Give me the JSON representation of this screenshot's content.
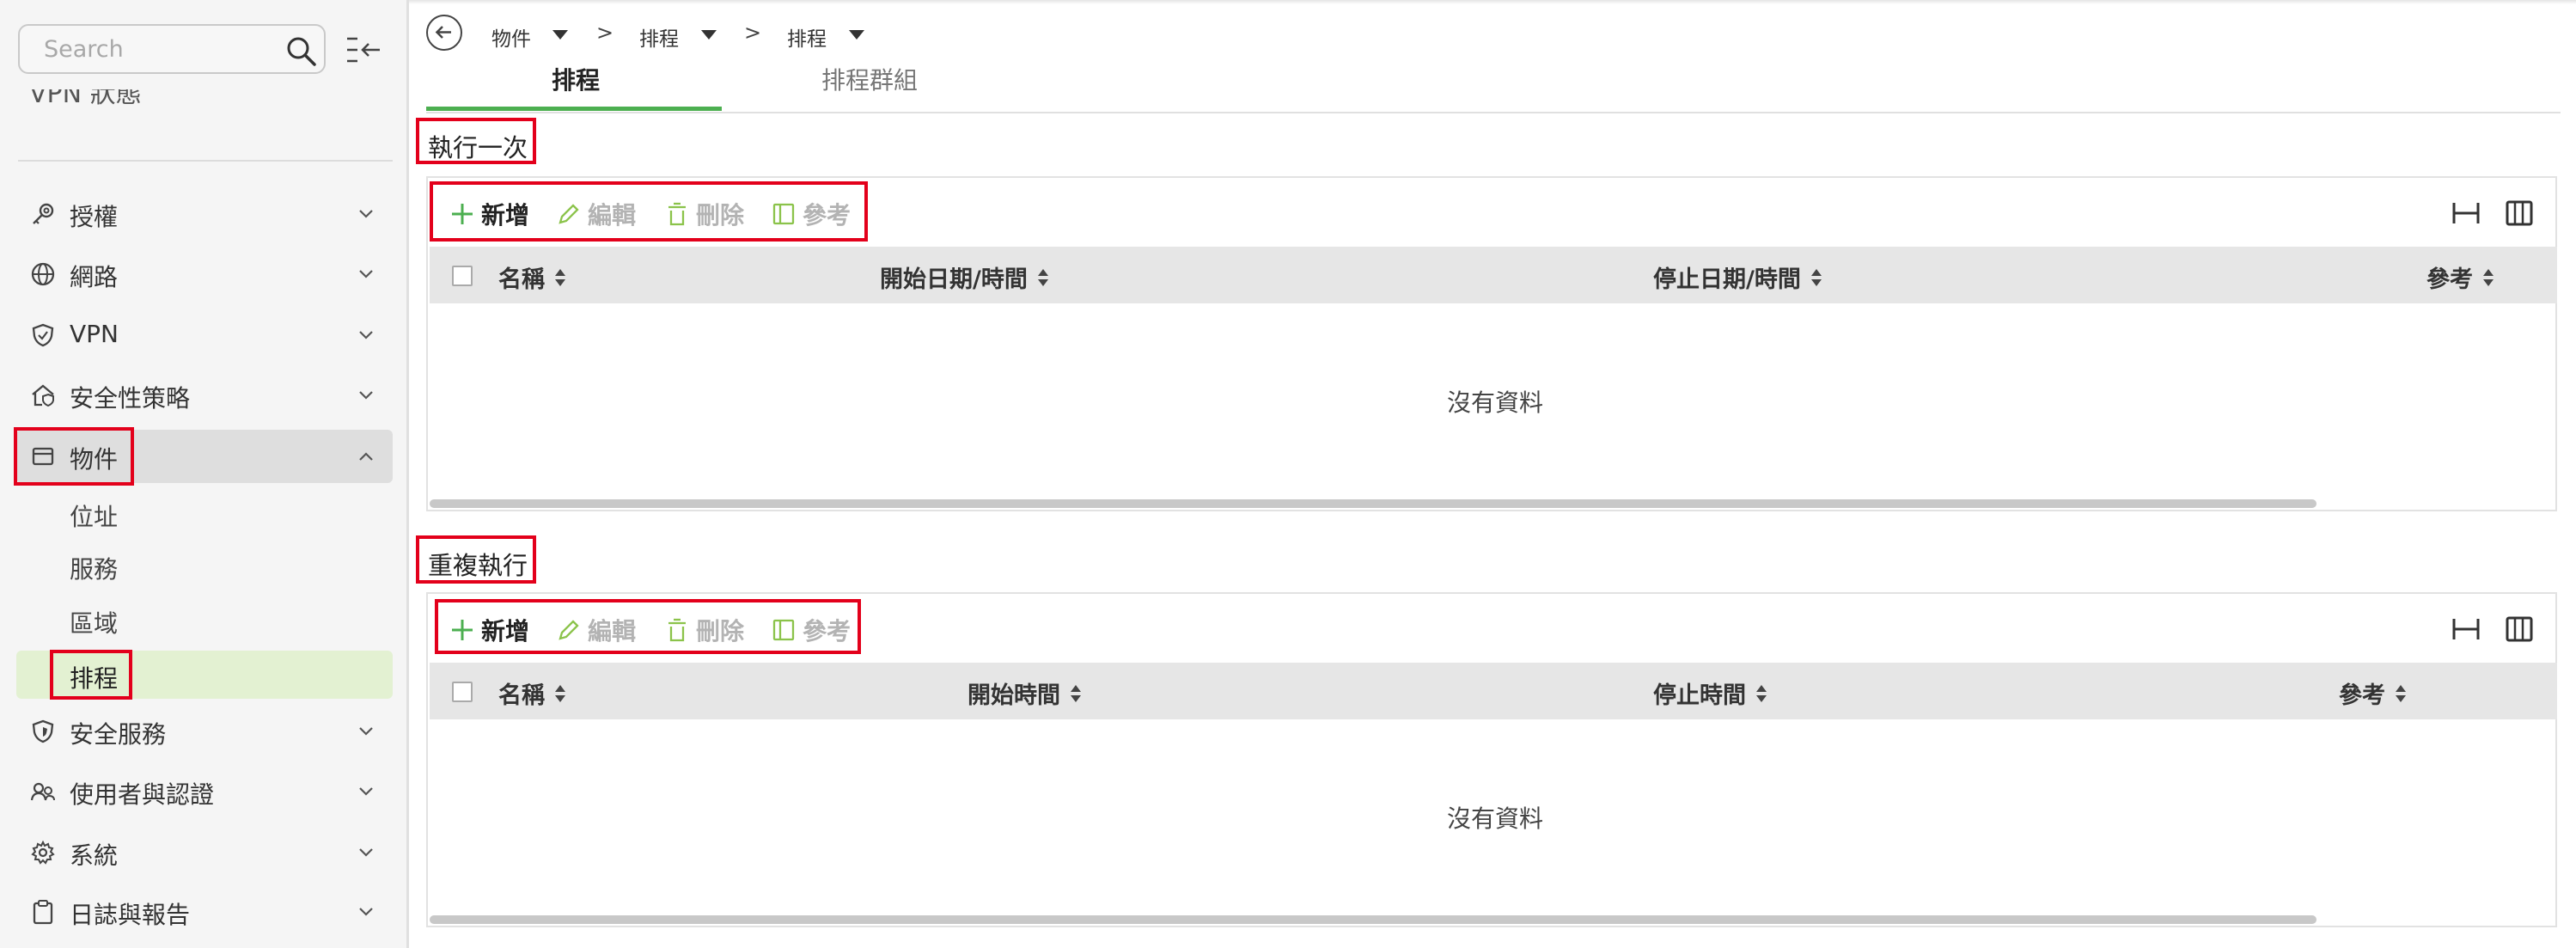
{
  "search": {
    "placeholder": "Search"
  },
  "sidebar": {
    "cut_item_label": "VPN 狀態",
    "items": [
      {
        "label": "授權",
        "icon": "key-icon"
      },
      {
        "label": "網路",
        "icon": "globe-icon"
      },
      {
        "label": "VPN",
        "icon": "shield-icon"
      },
      {
        "label": "安全性策略",
        "icon": "home-shield-icon"
      },
      {
        "label": "物件",
        "icon": "window-icon"
      },
      {
        "label": "安全服務",
        "icon": "security-service-icon"
      },
      {
        "label": "使用者與認證",
        "icon": "users-icon"
      },
      {
        "label": "系統",
        "icon": "gear-icon"
      },
      {
        "label": "日誌與報告",
        "icon": "clipboard-icon"
      }
    ],
    "sub_items": [
      {
        "label": "位址"
      },
      {
        "label": "服務"
      },
      {
        "label": "區域"
      },
      {
        "label": "排程"
      }
    ]
  },
  "breadcrumb": {
    "items": [
      "物件",
      "排程",
      "排程"
    ],
    "separator": ">"
  },
  "tabs": [
    {
      "label": "排程"
    },
    {
      "label": "排程群組"
    }
  ],
  "toolbar": {
    "add": "新增",
    "edit": "編輯",
    "delete": "刪除",
    "reference": "參考"
  },
  "sections": [
    {
      "title": "執行一次",
      "columns": [
        "名稱",
        "開始日期/時間",
        "停止日期/時間",
        "參考"
      ],
      "empty_text": "沒有資料"
    },
    {
      "title": "重複執行",
      "columns": [
        "名稱",
        "開始時間",
        "停止時間",
        "參考"
      ],
      "empty_text": "沒有資料"
    }
  ],
  "colors": {
    "accent_green": "#4caf50",
    "highlight_red": "#e3001b",
    "selected_bg": "#e3f1d2"
  }
}
